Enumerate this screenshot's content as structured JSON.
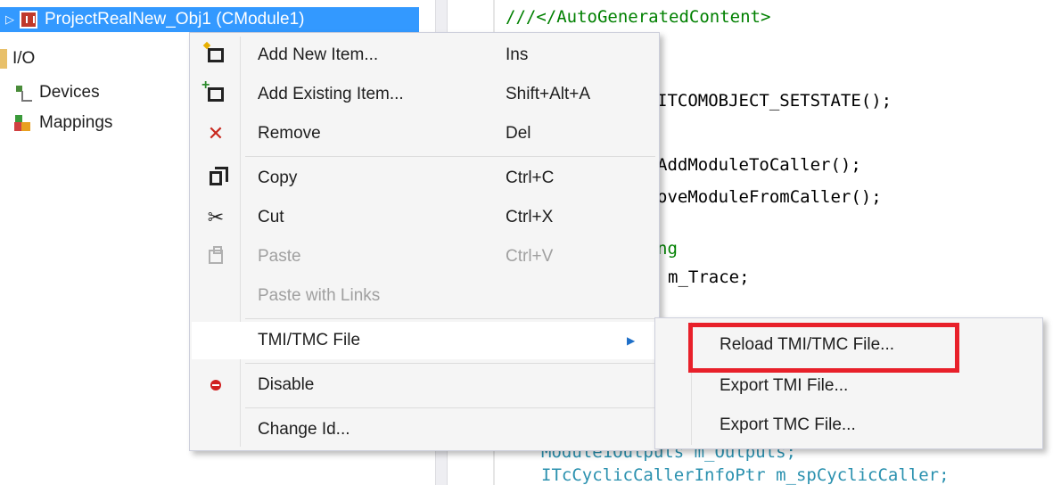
{
  "tree": {
    "items": [
      {
        "label": "ProjectRealNew_Obj1 (CModule1)"
      },
      {
        "label": "I/O"
      },
      {
        "label": "Devices"
      },
      {
        "label": "Mappings"
      }
    ]
  },
  "code": {
    "lines": [
      "///</AutoGeneratedContent>",
      "ITCOMOBJECT_SETSTATE();",
      "AddModuleToCaller();",
      "oveModuleFromCaller();",
      "ng",
      "m_Trace;",
      "Module1Outputs m_Outputs;",
      "ITcCyclicCallerInfoPtr m_spCyclicCaller;"
    ]
  },
  "context_menu": {
    "items": [
      {
        "label": "Add New Item...",
        "shortcut": "Ins",
        "icon": "add-new-item-icon",
        "enabled": true
      },
      {
        "label": "Add Existing Item...",
        "shortcut": "Shift+Alt+A",
        "icon": "add-existing-item-icon",
        "enabled": true
      },
      {
        "label": "Remove",
        "shortcut": "Del",
        "icon": "remove-icon",
        "enabled": true
      },
      {
        "label": "Copy",
        "shortcut": "Ctrl+C",
        "icon": "copy-icon",
        "enabled": true
      },
      {
        "label": "Cut",
        "shortcut": "Ctrl+X",
        "icon": "cut-icon",
        "enabled": true
      },
      {
        "label": "Paste",
        "shortcut": "Ctrl+V",
        "icon": "paste-icon",
        "enabled": false
      },
      {
        "label": "Paste with Links",
        "shortcut": "",
        "icon": "",
        "enabled": false
      },
      {
        "label": "TMI/TMC File",
        "shortcut": "",
        "icon": "submenu-arrow-icon",
        "enabled": true
      },
      {
        "label": "Disable",
        "shortcut": "",
        "icon": "disable-icon",
        "enabled": true
      },
      {
        "label": "Change Id...",
        "shortcut": "",
        "icon": "",
        "enabled": true
      }
    ]
  },
  "submenu": {
    "items": [
      {
        "label": "Reload TMI/TMC File..."
      },
      {
        "label": "Export TMI File..."
      },
      {
        "label": "Export TMC File..."
      }
    ]
  },
  "colors": {
    "selection": "#3399ff",
    "highlight_box": "#e8202a",
    "menu_bg": "#f5f5f5"
  }
}
